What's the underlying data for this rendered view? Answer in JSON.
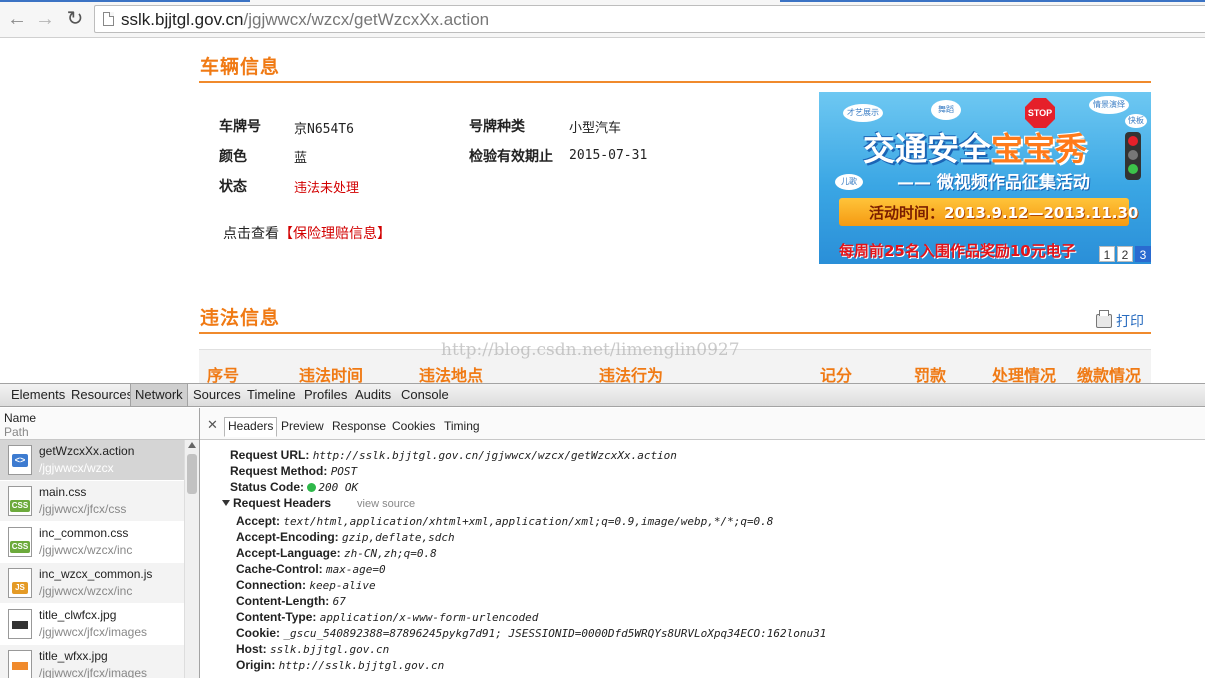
{
  "browser": {
    "url_host": "sslk.bjjtgl.gov.cn",
    "url_path": "/jgjwwcx/wzcx/getWzcxXx.action"
  },
  "vehicle_section": {
    "title": "车辆信息",
    "fields": {
      "plate_label": "车牌号",
      "plate_value": "京N654T6",
      "plate_type_label": "号牌种类",
      "plate_type_value": "小型汽车",
      "color_label": "颜色",
      "color_value": "蓝",
      "valid_label": "检验有效期止",
      "valid_value": "2015-07-31",
      "status_label": "状态",
      "status_value": "违法未处理"
    },
    "insurance_prefix": "点击查看",
    "insurance_link": "【保险理赔信息】"
  },
  "banner": {
    "title_a": "交通安全",
    "title_b": "宝宝秀",
    "subtitle": "—— 微视频作品征集活动",
    "time_label": "活动时间：",
    "time_value": "2013.9.12—2013.11.30",
    "bottom_text": "每周前25名入围作品奖励10元电子",
    "stop": "STOP",
    "clouds": [
      "才艺展示",
      "舞蹈",
      "情景演绎",
      "儿歌",
      "快板"
    ],
    "pages": [
      "1",
      "2",
      "3"
    ]
  },
  "violation_section": {
    "title": "违法信息",
    "print_label": "打印",
    "columns": [
      "序号",
      "违法时间",
      "违法地点",
      "违法行为",
      "记分",
      "罚款",
      "处理情况",
      "缴款情况"
    ]
  },
  "watermark": "http://blog.csdn.net/limenglin0927",
  "devtools": {
    "tabs": [
      "Elements",
      "Resources",
      "Network",
      "Sources",
      "Timeline",
      "Profiles",
      "Audits",
      "Console"
    ],
    "active_tab": "Network",
    "list_header": {
      "name": "Name",
      "path": "Path"
    },
    "requests": [
      {
        "name": "getWzcxXx.action",
        "path": "/jgjwwcx/wzcx",
        "icon": "html-file-icon"
      },
      {
        "name": "main.css",
        "path": "/jgjwwcx/jfcx/css",
        "icon": "css-file-icon"
      },
      {
        "name": "inc_common.css",
        "path": "/jgjwwcx/wzcx/inc",
        "icon": "css-file-icon"
      },
      {
        "name": "inc_wzcx_common.js",
        "path": "/jgjwwcx/wzcx/inc",
        "icon": "js-file-icon"
      },
      {
        "name": "title_clwfcx.jpg",
        "path": "/jgjwwcx/jfcx/images",
        "icon": "image-file-icon"
      },
      {
        "name": "title_wfxx.jpg",
        "path": "/jgjwwcx/jfcx/images",
        "icon": "image-file-icon"
      }
    ],
    "detail_tabs": [
      "Headers",
      "Preview",
      "Response",
      "Cookies",
      "Timing"
    ],
    "headers": {
      "request_url_key": "Request URL:",
      "request_url": "http://sslk.bjjtgl.gov.cn/jgjwwcx/wzcx/getWzcxXx.action",
      "method_key": "Request Method:",
      "method": "POST",
      "status_key": "Status Code:",
      "status": "200 OK",
      "req_headers_key": "Request Headers",
      "view_source": "view source",
      "items": [
        {
          "k": "Accept:",
          "v": "text/html,application/xhtml+xml,application/xml;q=0.9,image/webp,*/*;q=0.8"
        },
        {
          "k": "Accept-Encoding:",
          "v": "gzip,deflate,sdch"
        },
        {
          "k": "Accept-Language:",
          "v": "zh-CN,zh;q=0.8"
        },
        {
          "k": "Cache-Control:",
          "v": "max-age=0"
        },
        {
          "k": "Connection:",
          "v": "keep-alive"
        },
        {
          "k": "Content-Length:",
          "v": "67"
        },
        {
          "k": "Content-Type:",
          "v": "application/x-www-form-urlencoded"
        },
        {
          "k": "Cookie:",
          "v": "_gscu_540892388=87896245pykg7d91; JSESSIONID=0000Dfd5WRQYs8URVLoXpq34ECO:162lonu31"
        },
        {
          "k": "Host:",
          "v": "sslk.bjjtgl.gov.cn"
        },
        {
          "k": "Origin:",
          "v": "http://sslk.bjjtgl.gov.cn"
        }
      ]
    }
  }
}
